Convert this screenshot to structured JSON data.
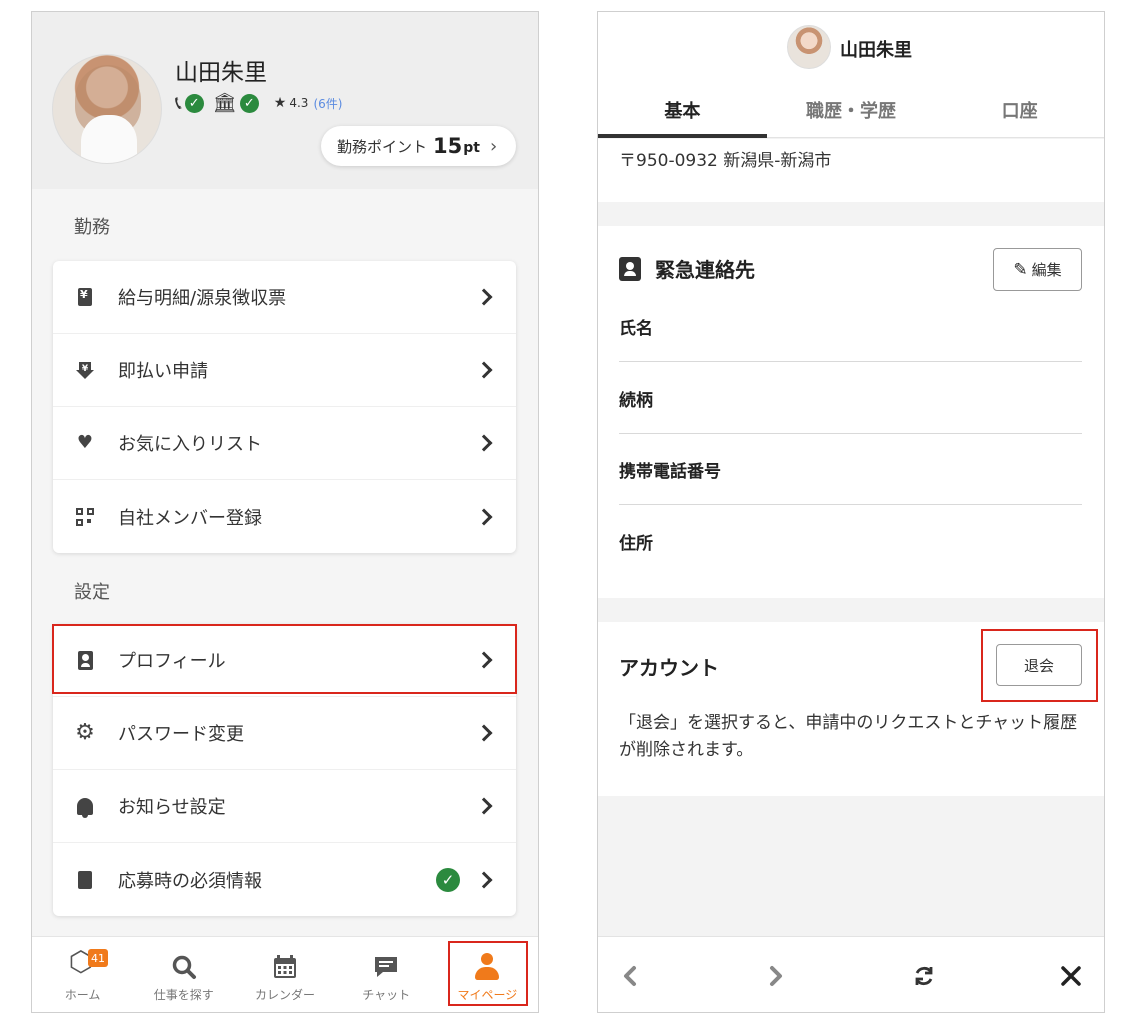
{
  "left": {
    "profile": {
      "name": "山田朱里",
      "rating": "4.3",
      "rating_count": "(6件)",
      "points_label": "勤務ポイント",
      "points_value": "15",
      "points_unit": "pt"
    },
    "sections": {
      "work_label": "勤務",
      "settings_label": "設定"
    },
    "work_items": [
      {
        "label": "給与明細/源泉徴収票",
        "icon": "yen-document-icon"
      },
      {
        "label": "即払い申請",
        "icon": "yen-download-icon"
      },
      {
        "label": "お気に入りリスト",
        "icon": "heart-icon"
      },
      {
        "label": "自社メンバー登録",
        "icon": "qr-code-icon"
      }
    ],
    "settings_items": [
      {
        "label": "プロフィール",
        "icon": "profile-card-icon"
      },
      {
        "label": "パスワード変更",
        "icon": "gear-icon"
      },
      {
        "label": "お知らせ設定",
        "icon": "bell-icon"
      },
      {
        "label": "応募時の必須情報",
        "icon": "document-icon"
      }
    ],
    "bottom_nav": [
      {
        "label": "ホーム",
        "icon": "home-hex-icon",
        "badge": "41"
      },
      {
        "label": "仕事を探す",
        "icon": "search-icon"
      },
      {
        "label": "カレンダー",
        "icon": "calendar-icon"
      },
      {
        "label": "チャット",
        "icon": "chat-icon"
      },
      {
        "label": "マイページ",
        "icon": "person-icon"
      }
    ],
    "colors": {
      "accent": "#f07a1b",
      "highlight": "#d9261c",
      "check": "#2b8a3e"
    }
  },
  "right": {
    "header": {
      "name": "山田朱里"
    },
    "tabs": [
      "基本",
      "職歴・学歴",
      "口座"
    ],
    "address": "〒950-0932 新潟県-新潟市",
    "emergency": {
      "title": "緊急連絡先",
      "edit_label": "編集",
      "fields": [
        "氏名",
        "続柄",
        "携帯電話番号",
        "住所"
      ]
    },
    "account": {
      "title": "アカウント",
      "withdraw_label": "退会",
      "note": "「退会」を選択すると、申請中のリクエストとチャット履歴が削除されます。"
    }
  }
}
